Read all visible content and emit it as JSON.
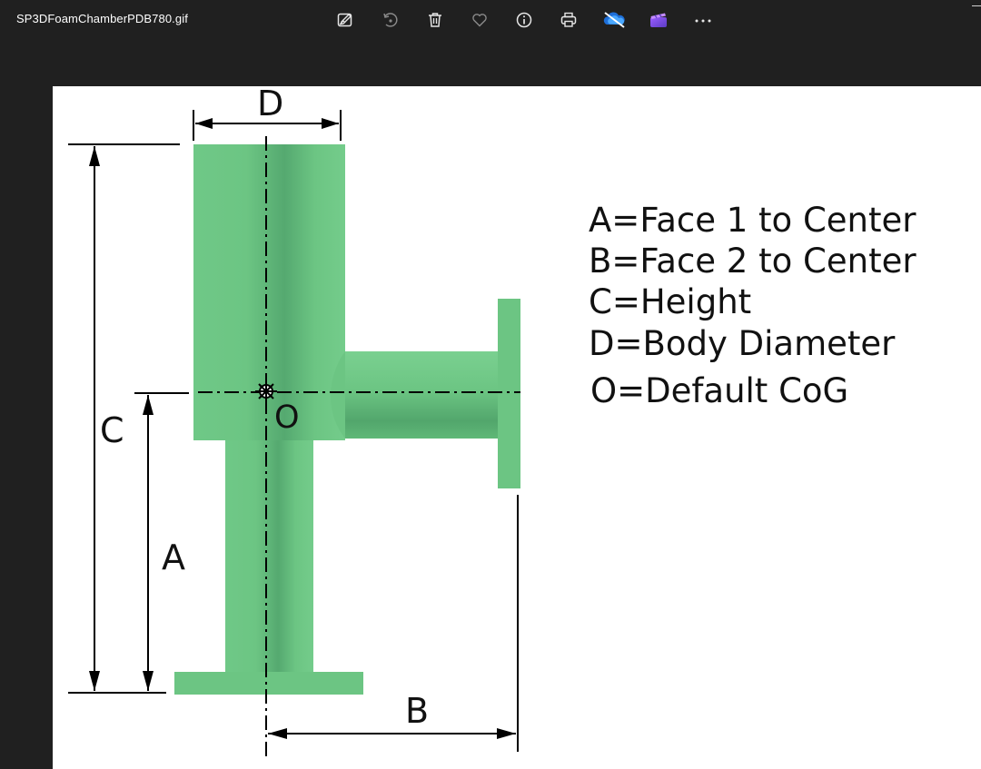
{
  "window": {
    "filename": "SP3DFoamChamberPDB780.gif"
  },
  "toolbar": {
    "buttons": [
      {
        "name": "edit-image-button",
        "icon": "edit-image-icon",
        "label": "Edit image"
      },
      {
        "name": "rotate-button",
        "icon": "rotate-icon",
        "label": "Rotate"
      },
      {
        "name": "delete-button",
        "icon": "trash-icon",
        "label": "Delete"
      },
      {
        "name": "favorite-button",
        "icon": "heart-icon",
        "label": "Favorite"
      },
      {
        "name": "file-info-button",
        "icon": "info-icon",
        "label": "File info"
      },
      {
        "name": "print-button",
        "icon": "printer-icon",
        "label": "Print"
      },
      {
        "name": "onedrive-button",
        "icon": "cloud-off-icon",
        "label": "OneDrive"
      },
      {
        "name": "clipchamp-button",
        "icon": "clipchamp-icon",
        "label": "Clipchamp"
      },
      {
        "name": "more-button",
        "icon": "ellipsis-icon",
        "label": "More"
      }
    ]
  },
  "diagram": {
    "dimension_labels": {
      "a": "A",
      "b": "B",
      "c": "C",
      "d": "D",
      "o": "O"
    },
    "legend": [
      "A=Face 1 to Center",
      "B=Face 2 to Center",
      "C=Height",
      "D=Body Diameter",
      "O=Default CoG"
    ],
    "colors": {
      "body": "#6cc583",
      "body_shade": "#4fa56a",
      "line": "#000000",
      "background": "#ffffff"
    }
  }
}
